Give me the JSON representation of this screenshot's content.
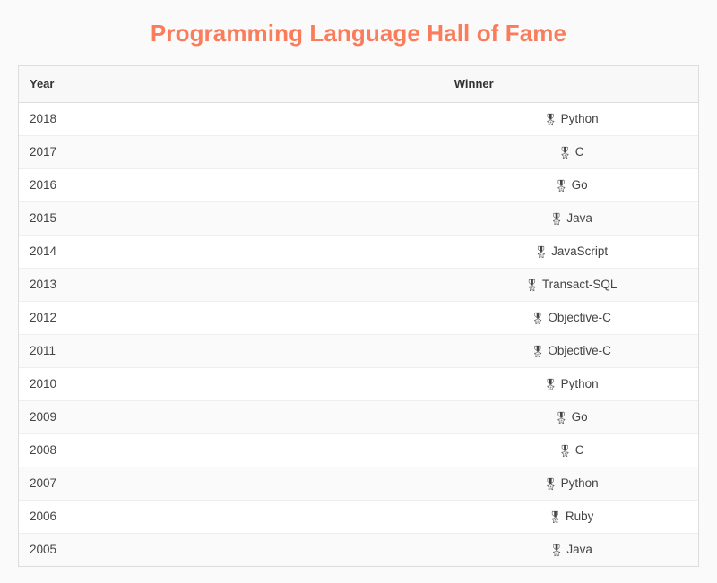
{
  "page": {
    "title": "Programming Language Hall of Fame",
    "title_color": "#fa7c5a",
    "background_color": "#fafafa"
  },
  "table": {
    "columns": [
      {
        "key": "year",
        "label": "Year"
      },
      {
        "key": "winner",
        "label": "Winner"
      }
    ],
    "winner_icon": "military-medal-icon",
    "winner_icon_glyph": "🎖",
    "rows": [
      {
        "year": "2018",
        "winner": "Python"
      },
      {
        "year": "2017",
        "winner": "C"
      },
      {
        "year": "2016",
        "winner": "Go"
      },
      {
        "year": "2015",
        "winner": "Java"
      },
      {
        "year": "2014",
        "winner": "JavaScript"
      },
      {
        "year": "2013",
        "winner": "Transact-SQL"
      },
      {
        "year": "2012",
        "winner": "Objective-C"
      },
      {
        "year": "2011",
        "winner": "Objective-C"
      },
      {
        "year": "2010",
        "winner": "Python"
      },
      {
        "year": "2009",
        "winner": "Go"
      },
      {
        "year": "2008",
        "winner": "C"
      },
      {
        "year": "2007",
        "winner": "Python"
      },
      {
        "year": "2006",
        "winner": "Ruby"
      },
      {
        "year": "2005",
        "winner": "Java"
      }
    ]
  }
}
